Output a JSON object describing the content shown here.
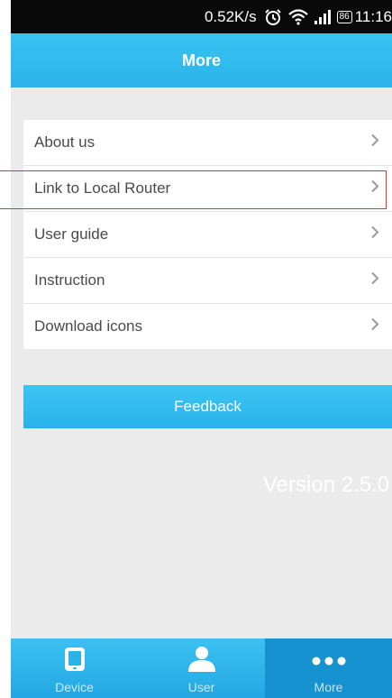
{
  "status_bar": {
    "speed": "0.52K/s",
    "battery": "86",
    "time": "11:16"
  },
  "header": {
    "title": "More"
  },
  "menu": {
    "items": [
      {
        "label": "About us"
      },
      {
        "label": "Link to Local Router"
      },
      {
        "label": "User guide"
      },
      {
        "label": "Instruction"
      },
      {
        "label": "Download icons"
      }
    ]
  },
  "feedback_label": "Feedback",
  "version": "Version 2.5.0",
  "tab_bar": {
    "tabs": [
      {
        "label": "Device",
        "icon": "tablet-icon"
      },
      {
        "label": "User",
        "icon": "person-icon"
      },
      {
        "label": "More",
        "icon": "more-dots-icon",
        "active": true
      }
    ]
  },
  "colors": {
    "accent": "#2bb3e9",
    "highlight_border": "#e0312f",
    "active_tab": "#1592cf"
  }
}
